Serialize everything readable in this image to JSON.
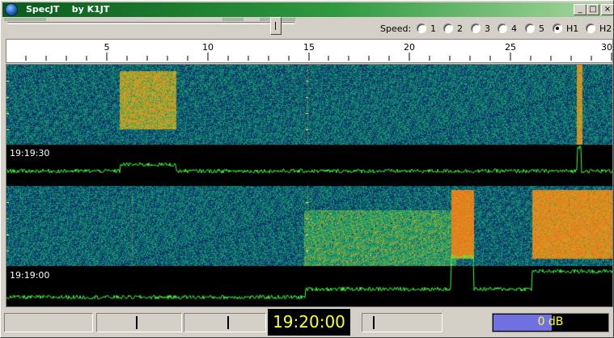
{
  "window": {
    "title": "SpecJT    by K1JT",
    "minimize": "_",
    "maximize": "□",
    "close": "×"
  },
  "speed": {
    "label": "Speed:",
    "options": [
      "1",
      "2",
      "3",
      "4",
      "5",
      "H1",
      "H2"
    ],
    "selected": "H1"
  },
  "ruler": {
    "ticks": [
      "5",
      "10",
      "15",
      "20",
      "25",
      "30"
    ],
    "min": 0,
    "max": 30
  },
  "waterfall": {
    "panels": [
      {
        "time": "19:19:30"
      },
      {
        "time": "19:19:00"
      }
    ]
  },
  "status": {
    "clock": "19:20:00",
    "level_text": "0 dB",
    "level_fraction": 0.5
  },
  "colors": {
    "title_start": "#0a5a1e",
    "trace": "#40ff40",
    "clock_text": "#ffff30",
    "level_fill": "#7070e0"
  }
}
